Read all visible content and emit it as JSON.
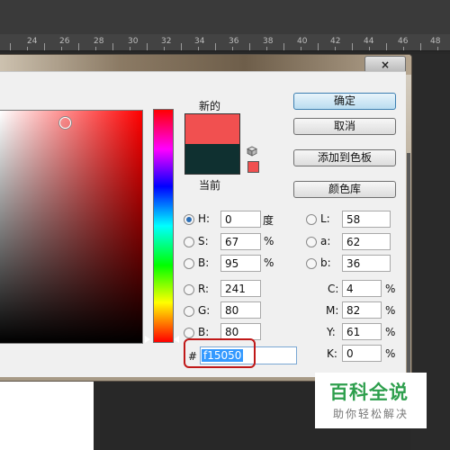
{
  "ruler": {
    "labels": [
      "24",
      "26",
      "28",
      "30",
      "32",
      "34",
      "36",
      "38",
      "40",
      "42",
      "44",
      "46",
      "48"
    ]
  },
  "dialog": {
    "close_label": "×",
    "new_label": "新的",
    "current_label": "当前",
    "new_color": "#f15050",
    "current_color": "#0f3030",
    "buttons": {
      "ok": "确定",
      "cancel": "取消",
      "add_swatch": "添加到色板",
      "color_library": "颜色库"
    },
    "hsb": {
      "h": {
        "label": "H:",
        "value": "0",
        "unit": "度",
        "selected": true
      },
      "s": {
        "label": "S:",
        "value": "67",
        "unit": "%"
      },
      "b": {
        "label": "B:",
        "value": "95",
        "unit": "%"
      }
    },
    "rgb": {
      "r": {
        "label": "R:",
        "value": "241"
      },
      "g": {
        "label": "G:",
        "value": "80"
      },
      "b": {
        "label": "B:",
        "value": "80"
      }
    },
    "lab": {
      "l": {
        "label": "L:",
        "value": "58"
      },
      "a": {
        "label": "a:",
        "value": "62"
      },
      "b": {
        "label": "b:",
        "value": "36"
      }
    },
    "cmyk": {
      "c": {
        "label": "C:",
        "value": "4",
        "unit": "%"
      },
      "m": {
        "label": "M:",
        "value": "82",
        "unit": "%"
      },
      "y": {
        "label": "Y:",
        "value": "61",
        "unit": "%"
      },
      "k": {
        "label": "K:",
        "value": "0",
        "unit": "%"
      }
    },
    "hex": {
      "label": "#",
      "value": "f15050"
    }
  },
  "watermark": {
    "title": "百科全说",
    "subtitle": "助你轻松解决"
  }
}
